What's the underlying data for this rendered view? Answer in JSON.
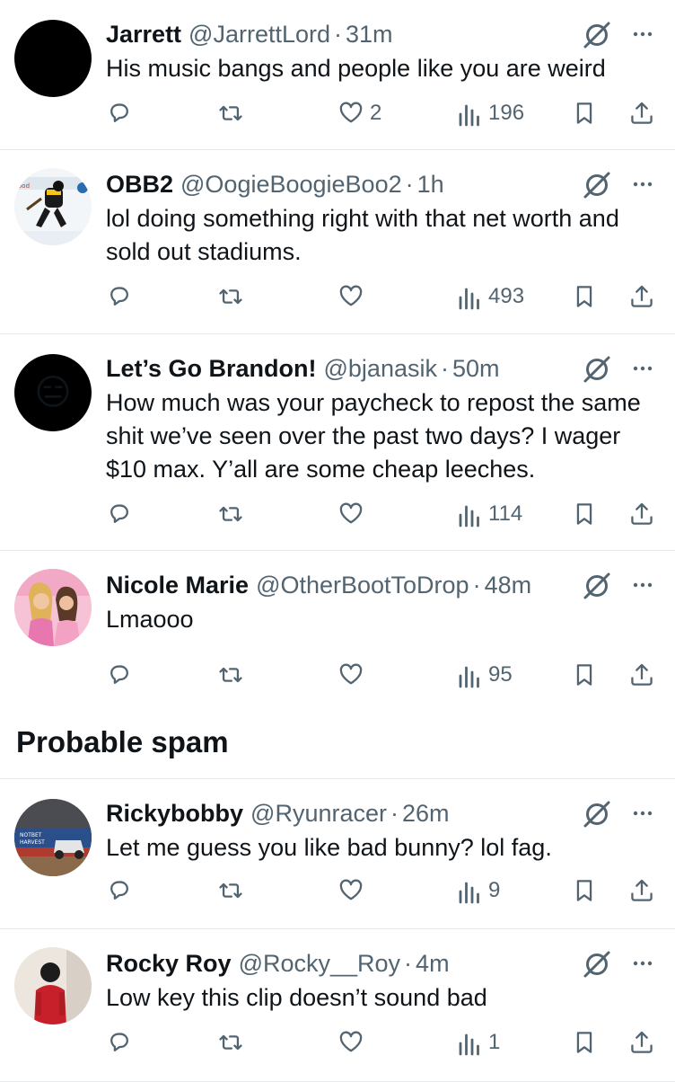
{
  "tweets": [
    {
      "name": "Jarrett",
      "handle": "@JarrettLord",
      "sep": "·",
      "time": "31m",
      "text": "His music bangs and people like you are weird",
      "replies": "",
      "retweets": "",
      "likes": "2",
      "views": "196"
    },
    {
      "name": "OBB2",
      "handle": "@OogieBoogieBoo2",
      "sep": "·",
      "time": "1h",
      "text": "lol doing something right with that net worth and sold out stadiums.",
      "replies": "",
      "retweets": "",
      "likes": "",
      "views": "493"
    },
    {
      "name": "Let’s Go Brandon!",
      "handle": "@bjanasik",
      "sep": "·",
      "time": "50m",
      "text": "How much was your paycheck to repost the same shit we’ve seen over the past two days? I wager $10 max. Y’all are some cheap leeches.",
      "replies": "",
      "retweets": "",
      "likes": "",
      "views": "114",
      "avatar_emoji": "😑"
    },
    {
      "name": "Nicole Marie",
      "handle": "@OtherBootToDrop",
      "sep": "·",
      "time": "48m",
      "text": "Lmaooo",
      "replies": "",
      "retweets": "",
      "likes": "",
      "views": "95"
    },
    {
      "name": "Rickybobby",
      "handle": "@Ryunracer",
      "sep": "·",
      "time": "26m",
      "text": "Let me guess you like bad bunny? lol fag.",
      "replies": "",
      "retweets": "",
      "likes": "",
      "views": "9"
    },
    {
      "name": "Rocky Roy",
      "handle": "@Rocky__Roy",
      "sep": "·",
      "time": "4m",
      "text": "Low key this clip doesn’t sound bad",
      "replies": "",
      "retweets": "",
      "likes": "",
      "views": "1"
    }
  ],
  "section": {
    "title": "Probable spam"
  },
  "icons": {
    "reply": "reply-icon",
    "retweet": "retweet-icon",
    "like": "heart-icon",
    "views": "views-icon",
    "bookmark": "bookmark-icon",
    "share": "share-icon",
    "grok": "grok-icon",
    "more": "more-icon"
  },
  "colors": {
    "text": "#0f1419",
    "secondary": "#536471",
    "border": "#e6e8ea"
  }
}
